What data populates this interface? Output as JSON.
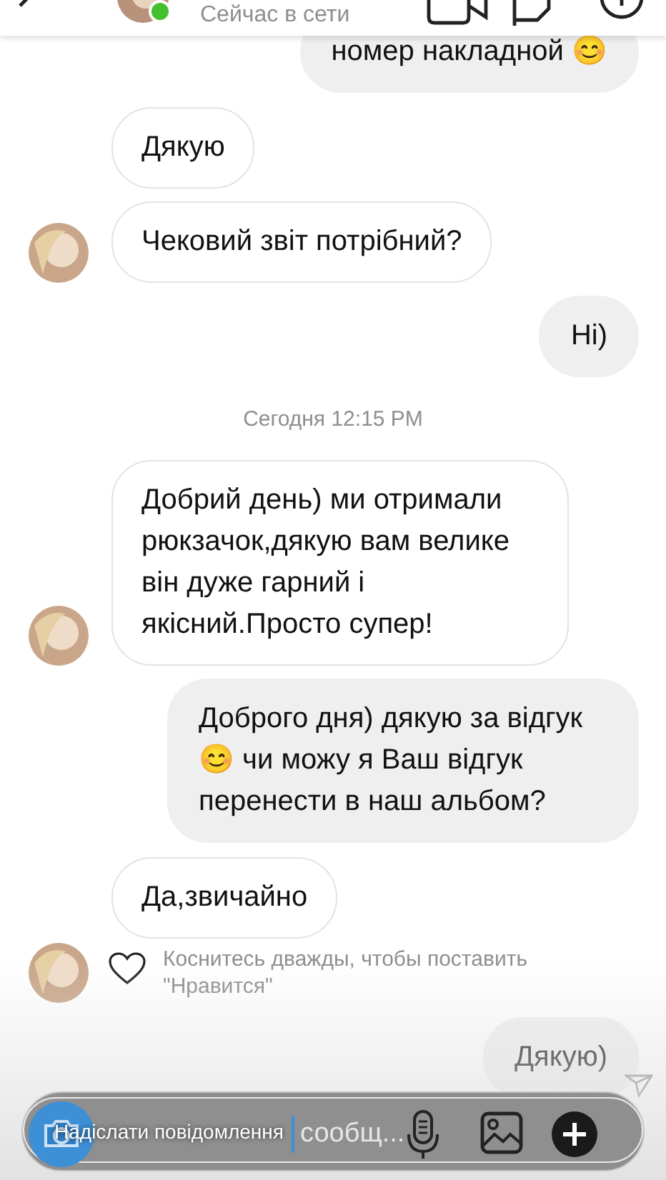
{
  "header": {
    "status": "Сейчас в сети",
    "online": true
  },
  "messages": [
    {
      "kind": "outgoing",
      "text": "номер накладной 😊"
    },
    {
      "kind": "incoming",
      "avatar": false,
      "text": "Дякую"
    },
    {
      "kind": "incoming",
      "avatar": true,
      "text": "Чековий звіт потрібний?"
    },
    {
      "kind": "outgoing",
      "text": "Ні)"
    },
    {
      "kind": "timestamp",
      "text": "Сегодня 12:15 PM"
    },
    {
      "kind": "incoming",
      "avatar": true,
      "text": "Добрий день) ми отримали рюкзачок,дякую вам велике він дуже гарний і якісний.Просто супер!"
    },
    {
      "kind": "outgoing",
      "text": "Доброго дня) дякую за відгук 😊 чи можу я Ваш відгук перенести в наш альбом?"
    },
    {
      "kind": "incoming",
      "avatar": false,
      "text": "Да,звичайно"
    },
    {
      "kind": "like_hint",
      "avatar": true,
      "text": "Коснитесь дважды, чтобы поставить \"Нравится\""
    },
    {
      "kind": "outgoing",
      "text": "Дякую)",
      "seen": true
    }
  ],
  "composer": {
    "placeholder": "сообщ...",
    "overlay_placeholder": "Надіслати повідомлення"
  }
}
